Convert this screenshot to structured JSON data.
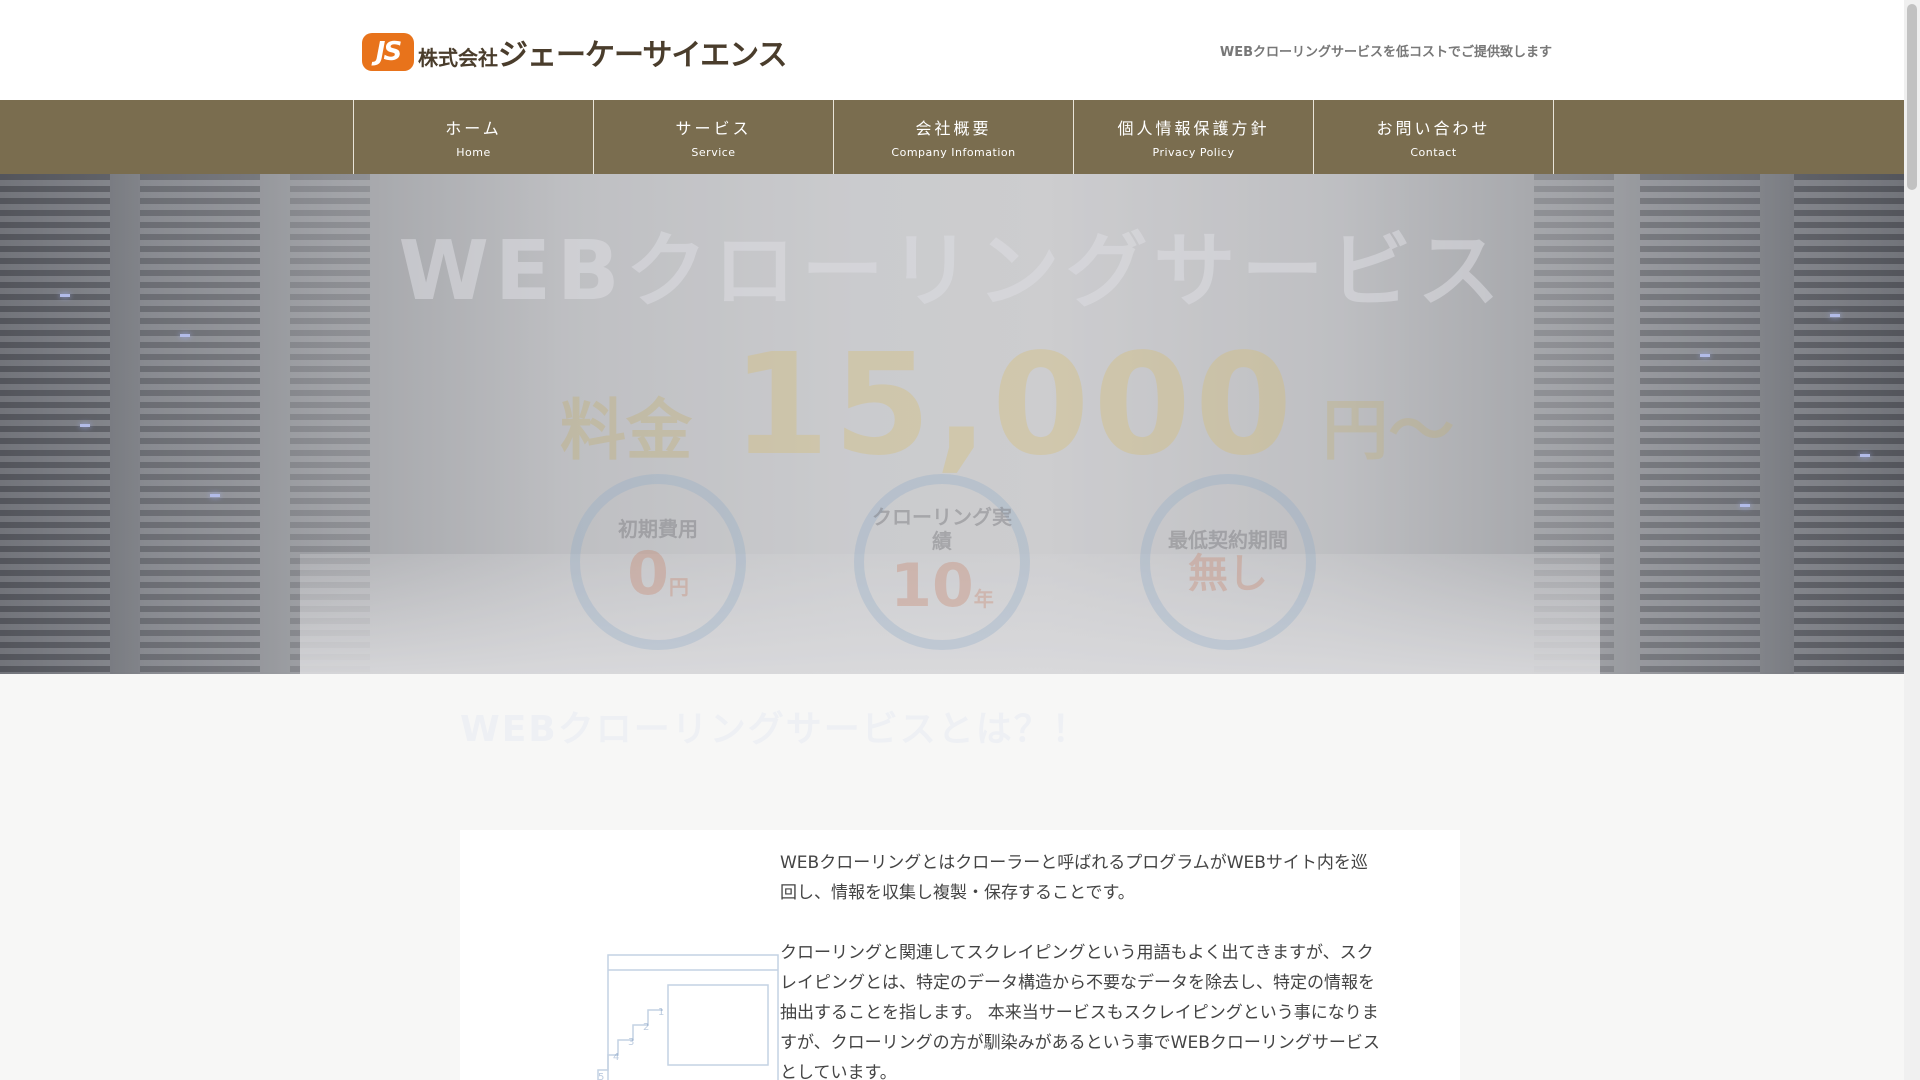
{
  "header": {
    "logo_badge": "JS",
    "logo_prefix": "株式会社",
    "logo_name": "ジェーケーサイエンス",
    "tagline": "WEBクローリングサービスを低コストでご提供致します"
  },
  "nav": {
    "items": [
      {
        "jp": "ホーム",
        "en": "Home"
      },
      {
        "jp": "サービス",
        "en": "Service"
      },
      {
        "jp": "会社概要",
        "en": "Company Infomation"
      },
      {
        "jp": "個人情報保護方針",
        "en": "Privacy Policy"
      },
      {
        "jp": "お問い合わせ",
        "en": "Contact"
      }
    ]
  },
  "hero": {
    "title": "WEBクローリングサービス",
    "price_label": "料金",
    "price_value": "15,000",
    "price_unit": "円〜",
    "circles": [
      {
        "label": "初期費用",
        "value": "0",
        "unit": "円"
      },
      {
        "label": "クローリング実績",
        "value": "10",
        "unit": "年"
      },
      {
        "label": "最低契約期間",
        "value": "無し",
        "unit": ""
      }
    ]
  },
  "section": {
    "title": "WEBクローリングサービスとは？！",
    "paragraphs": [
      "WEBクローリングとはクローラーと呼ばれるプログラムがWEBサイト内を巡回し、情報を収集し複製・保存することです。",
      "クローリングと関連してスクレイピングという用語もよく出てきますが、スクレイピングとは、特定のデータ構造から不要なデータを除去し、特定の情報を抽出することを指します。 本来当サービスもスクレイピングという事になりますが、クローリングの方が馴染みがあるという事でWEBクローリングサービスとしています。"
    ]
  },
  "colors": {
    "nav_bg": "#7a6d4f",
    "logo_orange": "#e8731b",
    "logo_brown": "#4a3d2c"
  }
}
